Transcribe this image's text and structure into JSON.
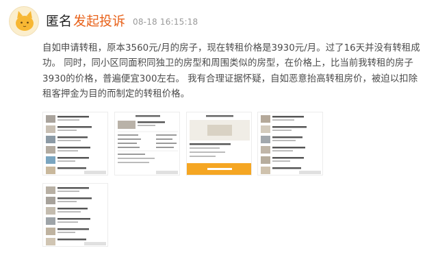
{
  "post": {
    "author": "匿名",
    "action_link": "发起投诉",
    "timestamp": "08-18 16:15:18",
    "content": "自如申请转租，原本3560元/月的房子，现在转租价格是3930元/月。过了16天并没有转租成功。 同时，同小区同面积同独卫的房型和周围类似的房型，在价格上，比当前我转租的房子3930的价格，普遍便宜300左右。 我有合理证据怀疑，自如恶意抬高转租房价，被迫以扣除租客押金为目的而制定的转租价格。"
  },
  "colors": {
    "link": "#e8621a",
    "avatar_bg": "#fbeecd",
    "cat": "#f7b733",
    "text": "#4a4a4a",
    "time": "#999999"
  },
  "attachments": [
    {
      "icon": "listing-screenshot-thumbnail"
    },
    {
      "icon": "detail-screenshot-thumbnail"
    },
    {
      "icon": "sublet-screenshot-thumbnail"
    },
    {
      "icon": "listing-screenshot-thumbnail"
    },
    {
      "icon": "listing-screenshot-thumbnail"
    }
  ]
}
